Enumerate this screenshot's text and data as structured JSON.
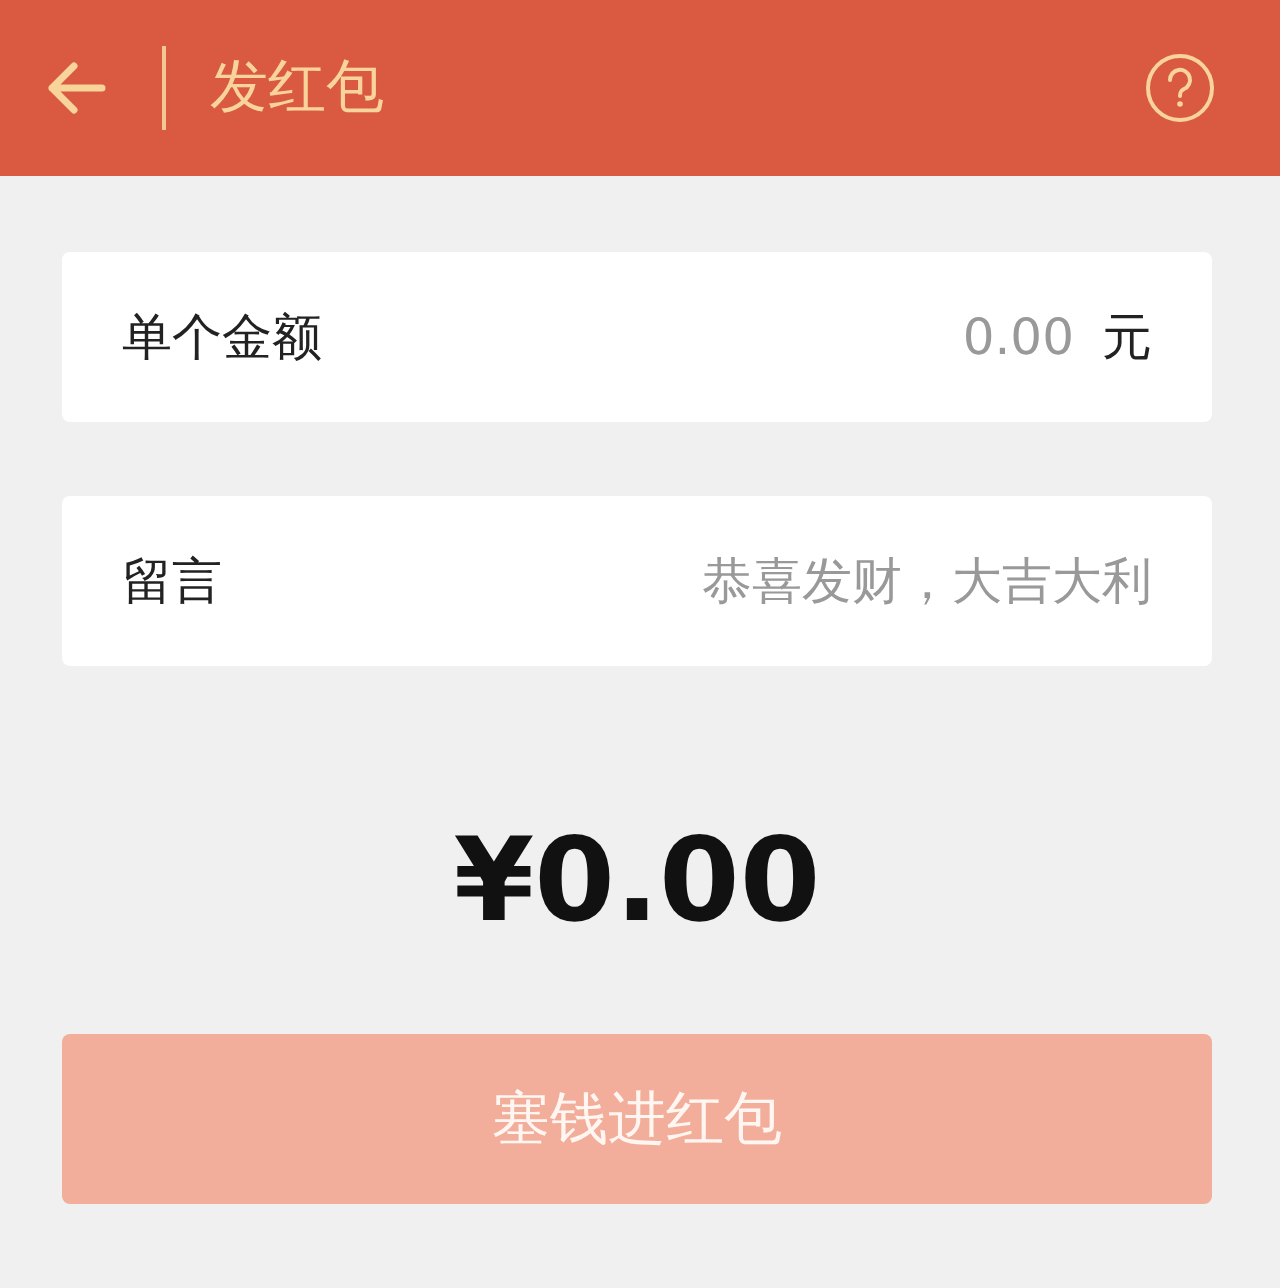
{
  "header": {
    "title": "发红包"
  },
  "fields": [
    {
      "label": "单个金额",
      "placeholder": "0.00",
      "unit": "元"
    },
    {
      "label": "留言",
      "placeholder": "恭喜发财，大吉大利"
    }
  ],
  "total": "¥0.00",
  "submit_button": {
    "label": "塞钱进红包",
    "disabled": true
  }
}
